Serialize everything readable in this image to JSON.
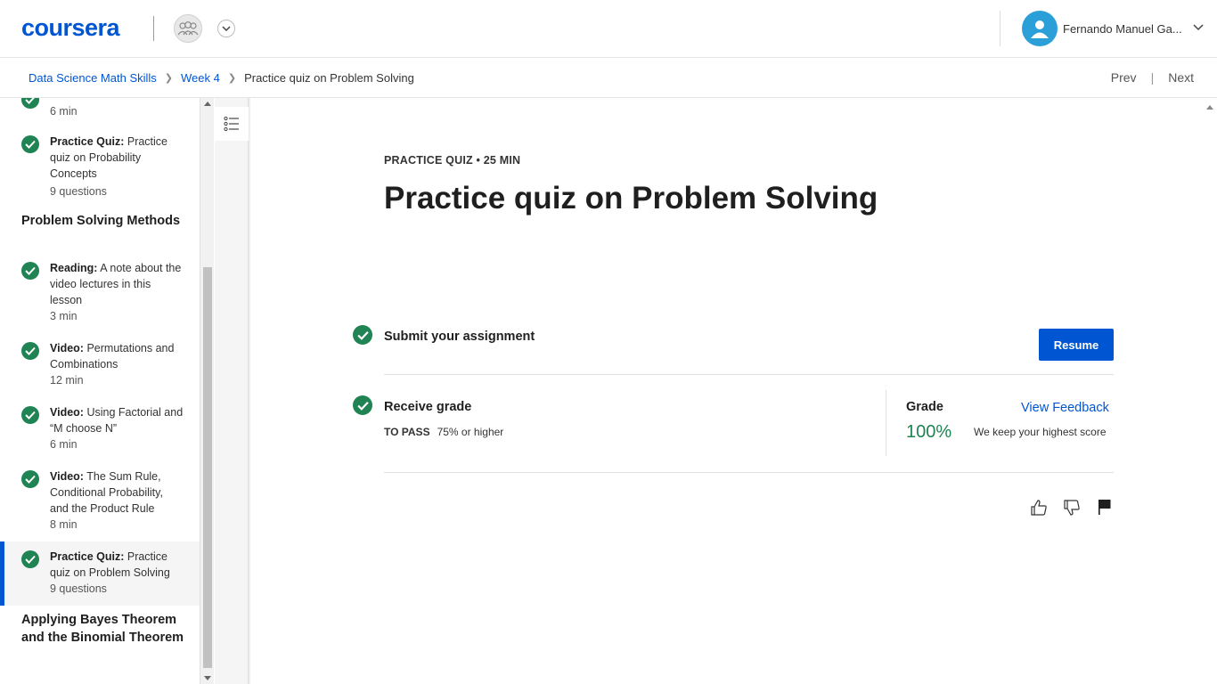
{
  "header": {
    "logo": "coursera",
    "user_name": "Fernando Manuel Ga...",
    "icons": [
      "group-icon",
      "chevron-down-icon",
      "user-icon",
      "chevron-down-icon"
    ]
  },
  "breadcrumb": {
    "items": [
      "Data Science Math Skills",
      "Week 4",
      "Practice quiz on Problem Solving"
    ],
    "prev": "Prev",
    "next": "Next"
  },
  "sidebar": {
    "partial_top": {
      "meta": "6 min"
    },
    "items": [
      {
        "type": "Practice Quiz:",
        "title": "Practice quiz on Probability Concepts",
        "meta": "9 questions"
      },
      {
        "type": "Reading:",
        "title": "A note about the video lectures in this lesson",
        "meta": "3 min"
      },
      {
        "type": "Video:",
        "title": "Permutations and Combinations",
        "meta": "12 min"
      },
      {
        "type": "Video:",
        "title": "Using Factorial and “M choose N”",
        "meta": "6 min"
      },
      {
        "type": "Video:",
        "title": "The Sum Rule, Conditional Probability, and the Product Rule",
        "meta": "8 min"
      },
      {
        "type": "Practice Quiz:",
        "title": "Practice quiz on Problem Solving",
        "meta": "9 questions"
      }
    ],
    "sections": [
      "Problem Solving Methods",
      "Applying Bayes Theorem and the Binomial Theorem"
    ]
  },
  "main": {
    "kicker": "PRACTICE QUIZ • 25 MIN",
    "title": "Practice quiz on Problem Solving",
    "submit_label": "Submit your assignment",
    "resume_label": "Resume",
    "receive_label": "Receive grade",
    "to_pass_label": "TO PASS",
    "to_pass_value": "75% or higher",
    "grade_label": "Grade",
    "grade_value": "100%",
    "view_feedback": "View Feedback",
    "highest_note": "We keep your highest score"
  },
  "colors": {
    "brand": "#0056d2",
    "success": "#1f8354"
  }
}
